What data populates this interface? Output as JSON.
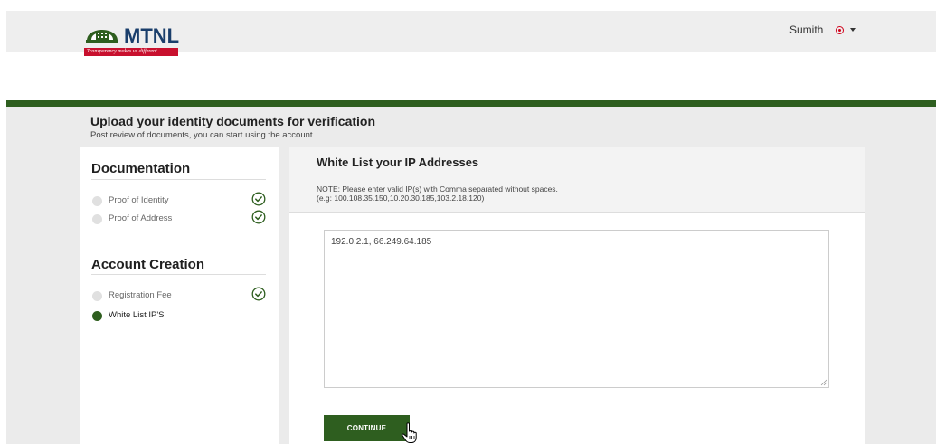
{
  "header": {
    "logo_text": "MTNL",
    "logo_tagline": "Transparency makes us different",
    "user_name": "Sumith"
  },
  "page": {
    "title": "Upload your identity documents for verification",
    "subtitle": "Post review of documents, you can start using the account"
  },
  "sidebar": {
    "sections": [
      {
        "title": "Documentation",
        "steps": [
          {
            "label": "Proof of Identity",
            "status": "completed"
          },
          {
            "label": "Proof of Address",
            "status": "completed"
          }
        ]
      },
      {
        "title": "Account Creation",
        "steps": [
          {
            "label": "Registration Fee",
            "status": "completed"
          },
          {
            "label": "White List IP'S",
            "status": "current"
          }
        ]
      }
    ]
  },
  "whitelist": {
    "title": "White List your IP Addresses",
    "note_line1": "NOTE: Please enter valid IP(s) with Comma separated without spaces.",
    "note_line2": "(e.g: 100.108.35.150,10.20.30.185,103.2.18.120)",
    "ip_value": "192.0.2.1, 66.249.64.185",
    "continue_label": "CONTINUE"
  },
  "colors": {
    "brand_green": "#2e5e1f",
    "brand_red": "#c8102e",
    "logo_blue": "#1a3e6b",
    "check_green": "#2e5e1f"
  },
  "icons": {
    "step_check": "check-circle-icon",
    "user": "user-icon",
    "caret": "caret-down-icon",
    "cursor": "hand-pointer-icon"
  }
}
